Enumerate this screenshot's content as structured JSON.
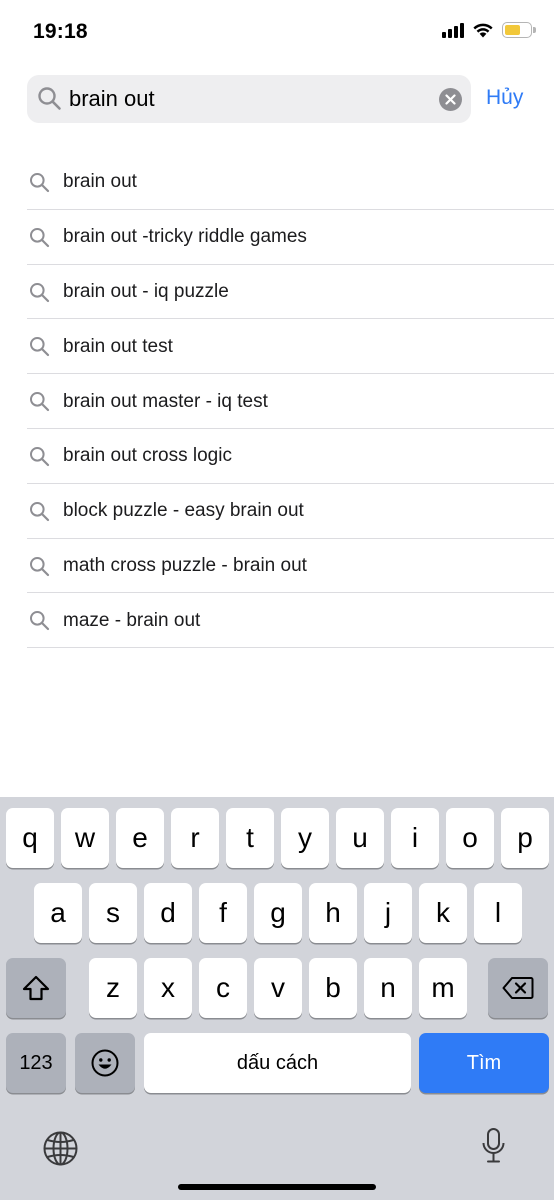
{
  "status_bar": {
    "time": "19:18"
  },
  "search": {
    "query": "brain out",
    "cancel_label": "Hủy"
  },
  "suggestions": [
    "brain out",
    "brain out -tricky riddle games",
    "brain out - iq puzzle",
    "brain out test",
    "brain out master - iq test",
    "brain out cross logic",
    "block puzzle - easy brain out",
    "math cross puzzle - brain out",
    "maze - brain out"
  ],
  "keyboard": {
    "row1": [
      "q",
      "w",
      "e",
      "r",
      "t",
      "y",
      "u",
      "i",
      "o",
      "p"
    ],
    "row2": [
      "a",
      "s",
      "d",
      "f",
      "g",
      "h",
      "j",
      "k",
      "l"
    ],
    "row3": [
      "z",
      "x",
      "c",
      "v",
      "b",
      "n",
      "m"
    ],
    "numbers_label": "123",
    "space_label": "dấu cách",
    "return_label": "Tìm"
  },
  "icons": {
    "search": "search-icon",
    "clear": "clear-icon",
    "shift": "shift-icon",
    "delete": "delete-icon",
    "emoji": "emoji-icon",
    "globe": "globe-icon",
    "microphone": "microphone-icon"
  },
  "colors": {
    "accent": "#2f7bf6",
    "keyboard_bg": "#d2d4da",
    "field_bg": "#eeeef0",
    "battery_fill": "#f2c83a"
  }
}
